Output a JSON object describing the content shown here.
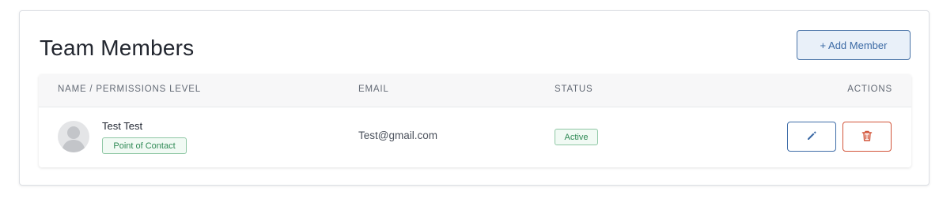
{
  "header": {
    "title": "Team Members",
    "add_button_label": "+ Add Member"
  },
  "table": {
    "columns": {
      "name": "NAME / PERMISSIONS LEVEL",
      "email": "EMAIL",
      "status": "STATUS",
      "actions": "ACTIONS"
    },
    "rows": [
      {
        "name": "Test Test",
        "role": "Point of Contact",
        "email": "Test@gmail.com",
        "status": "Active",
        "avatar_icon": "user-placeholder-icon",
        "edit_icon": "pencil-icon",
        "delete_icon": "trash-icon"
      }
    ]
  },
  "colors": {
    "accent_blue": "#3c6aa5",
    "danger_red": "#d2553a",
    "success_green": "#2f8a55"
  }
}
